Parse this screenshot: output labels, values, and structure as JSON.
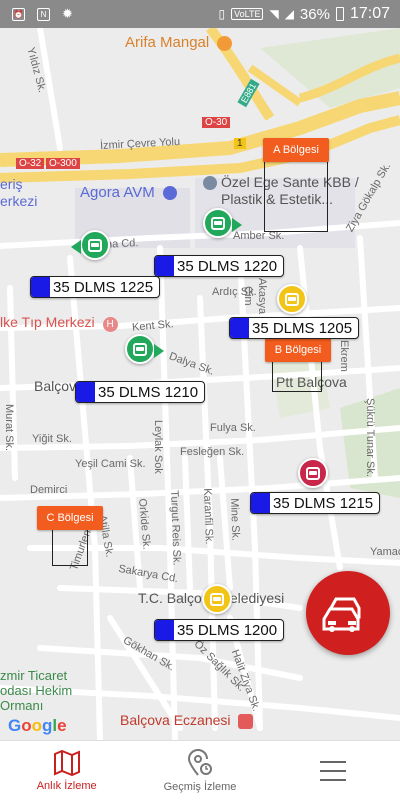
{
  "status_bar": {
    "time": "17:07",
    "battery": "36%",
    "network": "VoLTE",
    "left_icons": [
      "alarm-icon",
      "nfc-icon",
      "android-icon"
    ]
  },
  "map": {
    "street_labels": [
      "Yıldız Sk.",
      "İzmir Çevre Yolu",
      "O-30",
      "O-32",
      "O-300",
      "E881",
      "Amber Sk.",
      "Ziya Gökalp Sk.",
      "Ardıç Sk.",
      "Akasya",
      "Çim",
      "Kent Sk.",
      "Dalya Sk.",
      "Murat Sk.",
      "Yiğit Sk.",
      "Yeşil Cami Sk.",
      "Leylak Sok",
      "Fulya Sk.",
      "Fesleğen Sk.",
      "Demirci",
      "Ekrem",
      "Şükrü Tunar Sk.",
      "Timurlenk Sk.",
      "Atilla Sk.",
      "Orkide Sk.",
      "Turgut Reis Sk.",
      "Karanfil Sk.",
      "Mine Sk.",
      "Sakarya Cd.",
      "Gökhan Sk.",
      "Öz Sağlık Sk.",
      "Halit Ziya Sk.",
      "Yamaç",
      "1",
      "ma Cd."
    ],
    "poi_labels": {
      "arifa": "Arifa Mangal",
      "agora": "Agora AVM",
      "ozel_ege": "Özel Ege Sante KBB / Plastik & Estetik...",
      "eris": "eriş\nerkezi",
      "ilke": "lke Tıp Merkezi",
      "balcova": "Balçova",
      "ptt": "Ptt Balçova",
      "belediye": "T.C. Balçova Belediyesi",
      "eczane": "Balçova Eczanesi",
      "izmir_ticaret": "zmir Ticaret\nodası Hekim\nOrmanı"
    },
    "regions": [
      {
        "label": "A Bölgesi"
      },
      {
        "label": "B Bölgesi"
      },
      {
        "label": "C Bölgesi"
      }
    ],
    "vehicles": [
      {
        "plate": "35 DLMS 1220"
      },
      {
        "plate": "35 DLMS 1225"
      },
      {
        "plate": "35 DLMS 1205"
      },
      {
        "plate": "35 DLMS 1210"
      },
      {
        "plate": "35 DLMS 1215"
      },
      {
        "plate": "35 DLMS 1200"
      }
    ],
    "marker_colors": {
      "green": "#22a85a",
      "yellow": "#f2c417",
      "red": "#c8264a",
      "plate_blue": "#1a1ae6",
      "region_orange": "#f25c1e"
    },
    "attribution": "Google"
  },
  "fab": {
    "icon": "cars-icon",
    "color": "#d01f1f"
  },
  "bottom_nav": {
    "items": [
      {
        "label": "Anlık İzleme",
        "icon": "map-icon",
        "active": true
      },
      {
        "label": "Geçmiş İzleme",
        "icon": "history-pin-icon",
        "active": false
      },
      {
        "label": "",
        "icon": "menu-icon",
        "active": false
      }
    ]
  }
}
